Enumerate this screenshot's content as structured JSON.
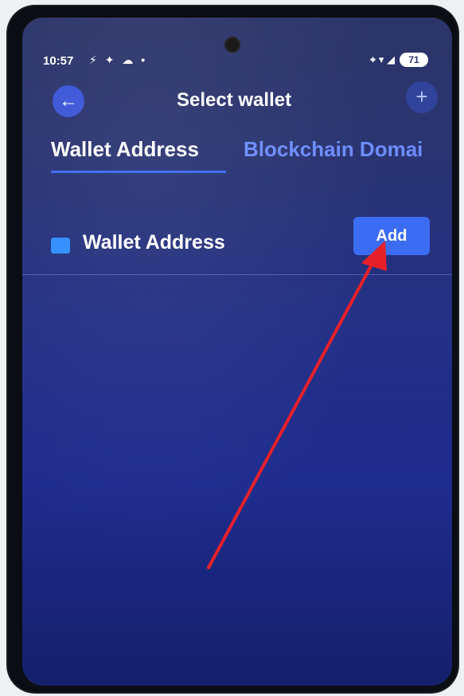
{
  "status_bar": {
    "time": "10:57",
    "left_icons": "⚡ ✦ ☁ •",
    "right_icons": "⌖ ▾ ◢",
    "battery": "71"
  },
  "header": {
    "back_icon": "←",
    "title": "Select wallet",
    "plus_icon": "+"
  },
  "tabs": [
    {
      "label": "Wallet Address",
      "active": true
    },
    {
      "label": "Blockchain Domai",
      "active": false
    }
  ],
  "wallet_row": {
    "label": "Wallet Address",
    "button_label": "Add"
  },
  "colors": {
    "background_top": "#2c3568",
    "background_bottom": "#1c2a88",
    "accent_blue": "#3b6cf2",
    "inactive_tab": "#6d8dff",
    "annotation_arrow": "#e8202a"
  },
  "icons": {
    "back": "back-arrow-icon",
    "plus": "plus-icon",
    "wallet": "wallet-icon"
  }
}
